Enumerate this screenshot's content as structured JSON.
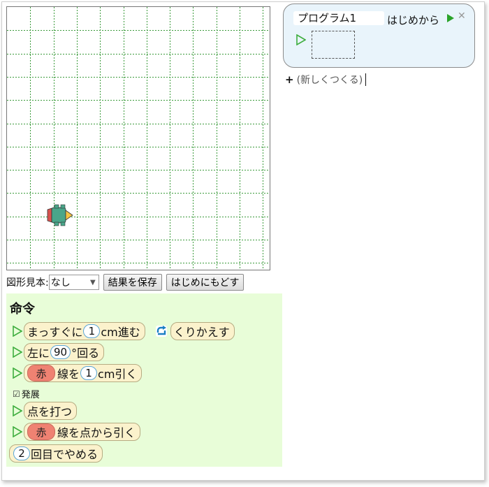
{
  "canvas": {
    "grid_color": "#3a9a3a",
    "turtle": {
      "body_color": "#4aa68a",
      "head_color": "#f5c343",
      "tail_color": "#d9534f",
      "heading": "right"
    }
  },
  "controls": {
    "shape_label": "図形見本:",
    "shape_value": "なし",
    "save_label": "結果を保存",
    "reset_label": "はじめにもどす"
  },
  "palette": {
    "title": "命令",
    "forward": {
      "text_before": "まっすぐに",
      "value": "1",
      "text_after": "cm進む"
    },
    "repeat": {
      "label": "くりかえす",
      "icon": "repeat-icon"
    },
    "turn_left": {
      "text_before": "左に",
      "value": "90",
      "text_after": "°回る"
    },
    "draw_line": {
      "color": "赤",
      "text_mid": "線を",
      "value": "1",
      "text_after": "cm引く"
    },
    "expand_label": "発展",
    "dot": {
      "label": "点を打つ"
    },
    "line_from_dot": {
      "color": "赤",
      "text_after": "線を点から引く"
    },
    "stop": {
      "value": "2",
      "text_after": "回目でやめる"
    }
  },
  "program": {
    "name": "プログラム1",
    "start_label": "はじめから",
    "run_icon": "play-icon",
    "close_icon": "close-icon"
  },
  "new_program": {
    "plus": "+",
    "label": "(新しくつくる)"
  },
  "colors": {
    "palette_bg": "#e8fdd8",
    "program_bg": "#e9f4fb",
    "block_bg": "#fbf2cc",
    "chip_red": "#ef8272"
  }
}
